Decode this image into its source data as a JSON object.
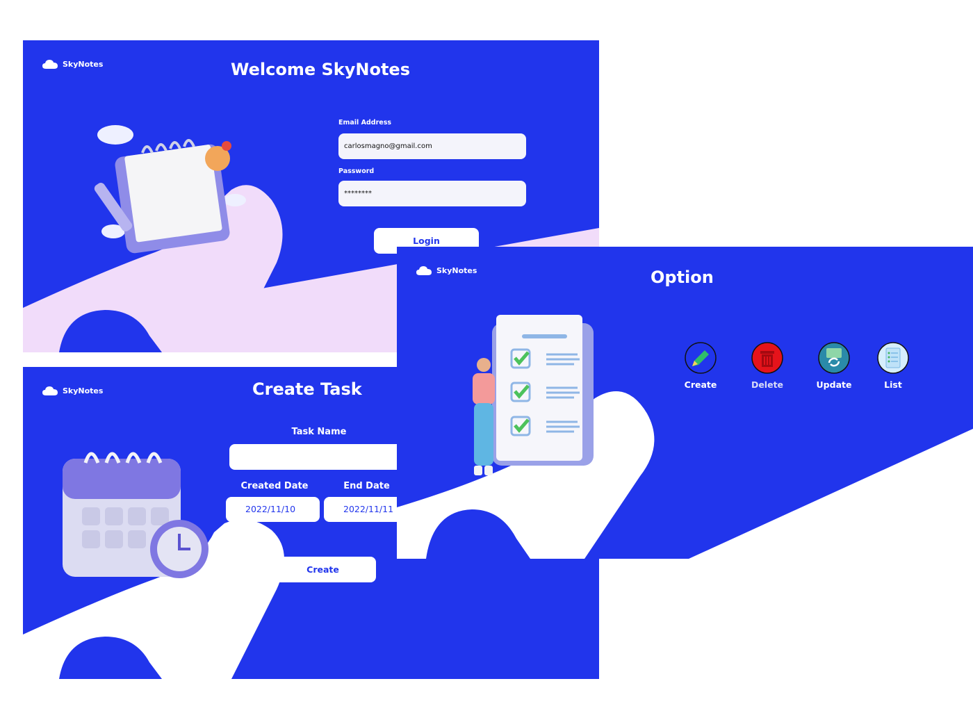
{
  "brand": {
    "name": "SkyNotes"
  },
  "login": {
    "title": "Welcome SkyNotes",
    "email_label": "Email Address",
    "email_value": "carlosmagno@gmail.com",
    "password_label": "Password",
    "password_value": "********",
    "login_button": "Login"
  },
  "create_task": {
    "title": "Create Task",
    "task_name_label": "Task Name",
    "task_name_value": "",
    "created_date_label": "Created Date",
    "created_date_value": "2022/11/10",
    "end_date_label": "End Date",
    "end_date_value": "2022/11/11",
    "create_button": "Create"
  },
  "option": {
    "title": "Option",
    "items": [
      {
        "label": "Create",
        "icon": "pencil-icon",
        "color": "#ffffff"
      },
      {
        "label": "Delete",
        "icon": "trash-icon",
        "color": "#d9dcf8"
      },
      {
        "label": "Update",
        "icon": "refresh-document-icon",
        "color": "#ffffff"
      },
      {
        "label": "List",
        "icon": "list-document-icon",
        "color": "#ffffff"
      }
    ]
  },
  "colors": {
    "brand_blue": "#2135ec",
    "lilac": "#f1dcfa",
    "white": "#ffffff"
  }
}
